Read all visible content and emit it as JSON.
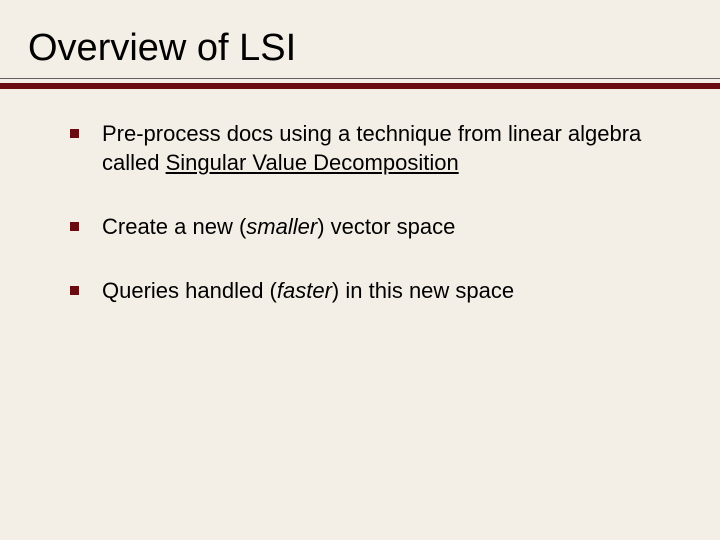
{
  "title": "Overview of LSI",
  "bullets": {
    "b1": {
      "t1": "Pre-process docs using a technique from linear algebra called ",
      "t2": "Singular Value Decomposition"
    },
    "b2": {
      "t1": "Create a new (",
      "t2": "smaller",
      "t3": ") vector space"
    },
    "b3": {
      "t1": "Queries handled (",
      "t2": "faster",
      "t3": ") in this new space"
    }
  }
}
